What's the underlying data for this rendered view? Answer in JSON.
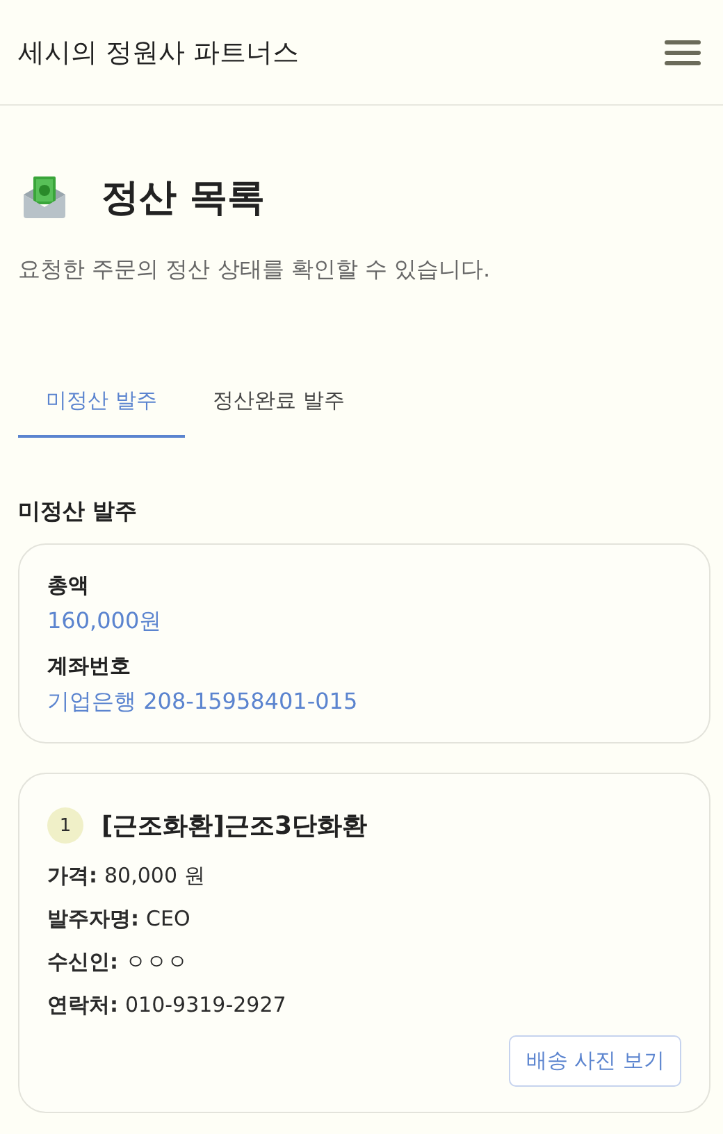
{
  "header": {
    "title": "세시의 정원사 파트너스"
  },
  "page": {
    "title": "정산 목록",
    "description": "요청한 주문의 정산 상태를 확인할 수 있습니다."
  },
  "tabs": [
    {
      "label": "미정산 발주",
      "selected": true
    },
    {
      "label": "정산완료 발주",
      "selected": false
    }
  ],
  "section": {
    "title": "미정산 발주"
  },
  "summary": [
    {
      "label": "총액",
      "value": "160,000원"
    },
    {
      "label": "계좌번호",
      "value": "기업은행 208-15958401-015"
    }
  ],
  "orders": [
    {
      "number": "1",
      "title": "[근조화환]근조3단화환",
      "fields": [
        {
          "label": "가격:",
          "value": "80,000 원"
        },
        {
          "label": "발주자명:",
          "value": "CEO"
        },
        {
          "label": "수신인:",
          "value": "ㅇㅇㅇ"
        },
        {
          "label": "연락처:",
          "value": "010-9319-2927"
        }
      ],
      "button": "배송 사진 보기"
    }
  ]
}
